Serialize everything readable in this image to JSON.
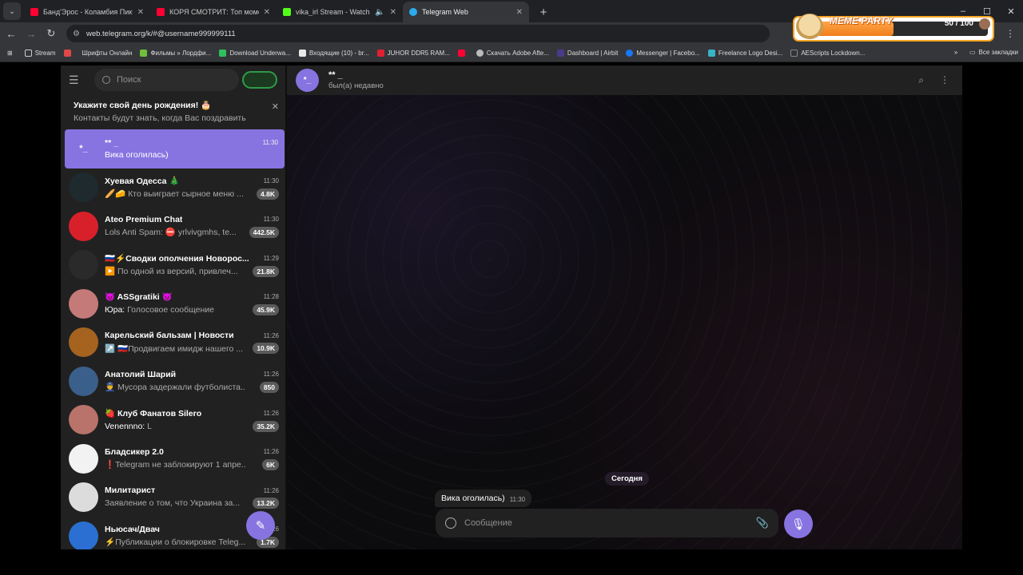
{
  "browser": {
    "tabs": [
      {
        "title": "Банд'Эрос - Коламбия Пикчерз",
        "color": "#ff0033"
      },
      {
        "title": "КОРЯ СМОТРИТ: Топ моменты",
        "color": "#ff0033"
      },
      {
        "title": "vika_irl Stream - Watch Live",
        "color": "#53fc18"
      },
      {
        "title": "Telegram Web",
        "color": "#2aabee"
      }
    ],
    "active_tab_index": 3,
    "url": "web.telegram.org/k/#@username999999111",
    "bookmarks": [
      "Stream",
      "",
      "Шрифты Онлайн",
      "Фильмы » Лордфи...",
      "Download Underwa...",
      "Входящие (10) - br...",
      "JUHOR DDR5 RAM...",
      "",
      "Скачать Adobe Afte...",
      "Dashboard | Airbit",
      "Messenger | Facebo...",
      "Freelance Logo Desi...",
      "AEScripts Lockdown..."
    ],
    "bookmarks_all": "Все закладки",
    "overlay": {
      "title": "MEME PARTY",
      "counter": "50 / 100",
      "progress": 0.5
    }
  },
  "telegram": {
    "search_placeholder": "Поиск",
    "birthday": {
      "title": "Укажите свой день рождения! 🎂",
      "subtitle": "Контакты будут знать, когда Вас поздравить"
    },
    "chats": [
      {
        "name": "** _",
        "time": "11:30",
        "sender": "",
        "msg": "Вика оголилась)",
        "badge": "",
        "avatar_text": "*_",
        "color": "#8774e1",
        "selected": true
      },
      {
        "name": "Хуевая Одесса 🎄",
        "time": "11:30",
        "sender": "",
        "msg": "🥖🧀 Кто выиграет сырное меню ...",
        "badge": "4.8K",
        "avatar_text": "",
        "color": "#1e2a2e",
        "selected": false
      },
      {
        "name": "Ateo Premium Chat",
        "time": "11:30",
        "sender": "",
        "msg": "Lols Anti Spam: ⛔ yrlvivgmhs, te...",
        "badge": "442.5K",
        "avatar_text": "",
        "color": "#d8202a",
        "selected": false
      },
      {
        "name": "🇷🇺⚡Сводки ополчения Новорос...",
        "time": "11:29",
        "sender": "",
        "msg": "▶️ По одной из версий, привлеч...",
        "badge": "21.8K",
        "avatar_text": "",
        "color": "#2a2a2a",
        "selected": false
      },
      {
        "name": "😈 ASSgratiki 😈",
        "time": "11:28",
        "sender": "Юра:",
        "msg": "Голосовое сообщение",
        "badge": "45.9K",
        "avatar_text": "",
        "color": "#c47a78",
        "selected": false
      },
      {
        "name": "Карельский бальзам | Новости",
        "time": "11:26",
        "sender": "",
        "msg": "↗️ 🇷🇺Продвигаем имидж нашего ...",
        "badge": "10.9K",
        "avatar_text": "",
        "color": "#a5631f",
        "selected": false
      },
      {
        "name": "Анатолий Шарий",
        "time": "11:26",
        "sender": "",
        "msg": "👮 Мусора задержали футболиста...",
        "badge": "850",
        "avatar_text": "",
        "color": "#3a5f8a",
        "selected": false
      },
      {
        "name": "🍓 Клуб Фанатов Silero",
        "time": "11:26",
        "sender": "Venennno:",
        "msg": "L",
        "badge": "35.2K",
        "avatar_text": "",
        "color": "#b9736a",
        "selected": false
      },
      {
        "name": "Бладсикер 2.0",
        "time": "11:26",
        "sender": "",
        "msg": "❗Telegram не заблокируют 1 апре...",
        "badge": "6K",
        "avatar_text": "",
        "color": "#f2f2f2",
        "selected": false
      },
      {
        "name": "Милитарист",
        "time": "11:26",
        "sender": "",
        "msg": "Заявление о том, что Украина за...",
        "badge": "13.2K",
        "avatar_text": "",
        "color": "#dcdcdc",
        "selected": false
      },
      {
        "name": "Ньюсач/Двач",
        "time": "11:26",
        "sender": "",
        "msg": "⚡Публикации о блокировке Teleg...",
        "badge": "1.7K",
        "avatar_text": "",
        "color": "#2a6fd1",
        "selected": false
      }
    ],
    "header": {
      "name": "** _",
      "status": "был(а) недавно",
      "avatar_text": "*_"
    },
    "date_divider": "Сегодня",
    "message": {
      "text": "Вика оголилась)",
      "time": "11:30"
    },
    "composer_placeholder": "Сообщение",
    "accent": "#8774e1"
  }
}
